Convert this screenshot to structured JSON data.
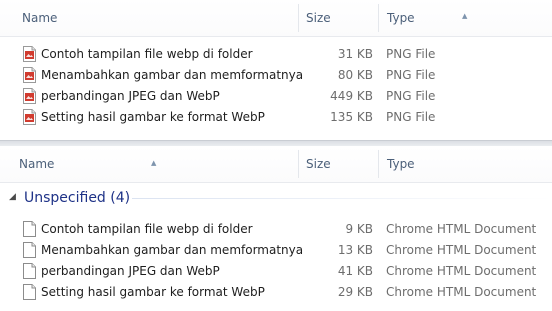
{
  "top_pane": {
    "headers": {
      "name": "Name",
      "size": "Size",
      "type": "Type"
    },
    "sort_icon": "sort-up-icon",
    "files": [
      {
        "name": "Contoh tampilan file webp di folder",
        "size": "31 KB",
        "type": "PNG File",
        "icon": "png-image-icon"
      },
      {
        "name": "Menambahkan gambar dan memformatnya",
        "size": "80 KB",
        "type": "PNG File",
        "icon": "png-image-icon"
      },
      {
        "name": "perbandingan JPEG dan WebP",
        "size": "449 KB",
        "type": "PNG File",
        "icon": "png-image-icon"
      },
      {
        "name": "Setting hasil gambar ke format WebP",
        "size": "135 KB",
        "type": "PNG File",
        "icon": "png-image-icon"
      }
    ]
  },
  "bottom_pane": {
    "headers": {
      "name": "Name",
      "size": "Size",
      "type": "Type"
    },
    "sort_icon": "sort-up-icon",
    "group": {
      "label": "Unspecified (4)",
      "icon": "collapse-chevron-icon"
    },
    "files": [
      {
        "name": "Contoh tampilan file webp di folder",
        "size": "9 KB",
        "type": "Chrome HTML Document",
        "icon": "blank-document-icon"
      },
      {
        "name": "Menambahkan gambar dan memformatnya",
        "size": "13 KB",
        "type": "Chrome HTML Document",
        "icon": "blank-document-icon"
      },
      {
        "name": "perbandingan JPEG dan WebP",
        "size": "41 KB",
        "type": "Chrome HTML Document",
        "icon": "blank-document-icon"
      },
      {
        "name": "Setting hasil gambar ke format WebP",
        "size": "29 KB",
        "type": "Chrome HTML Document",
        "icon": "blank-document-icon"
      }
    ]
  },
  "colors": {
    "header_text": "#4c607a",
    "group_label": "#1e3287",
    "meta_text": "#6d6d6d",
    "png_icon_accent": "#d13b2f"
  }
}
